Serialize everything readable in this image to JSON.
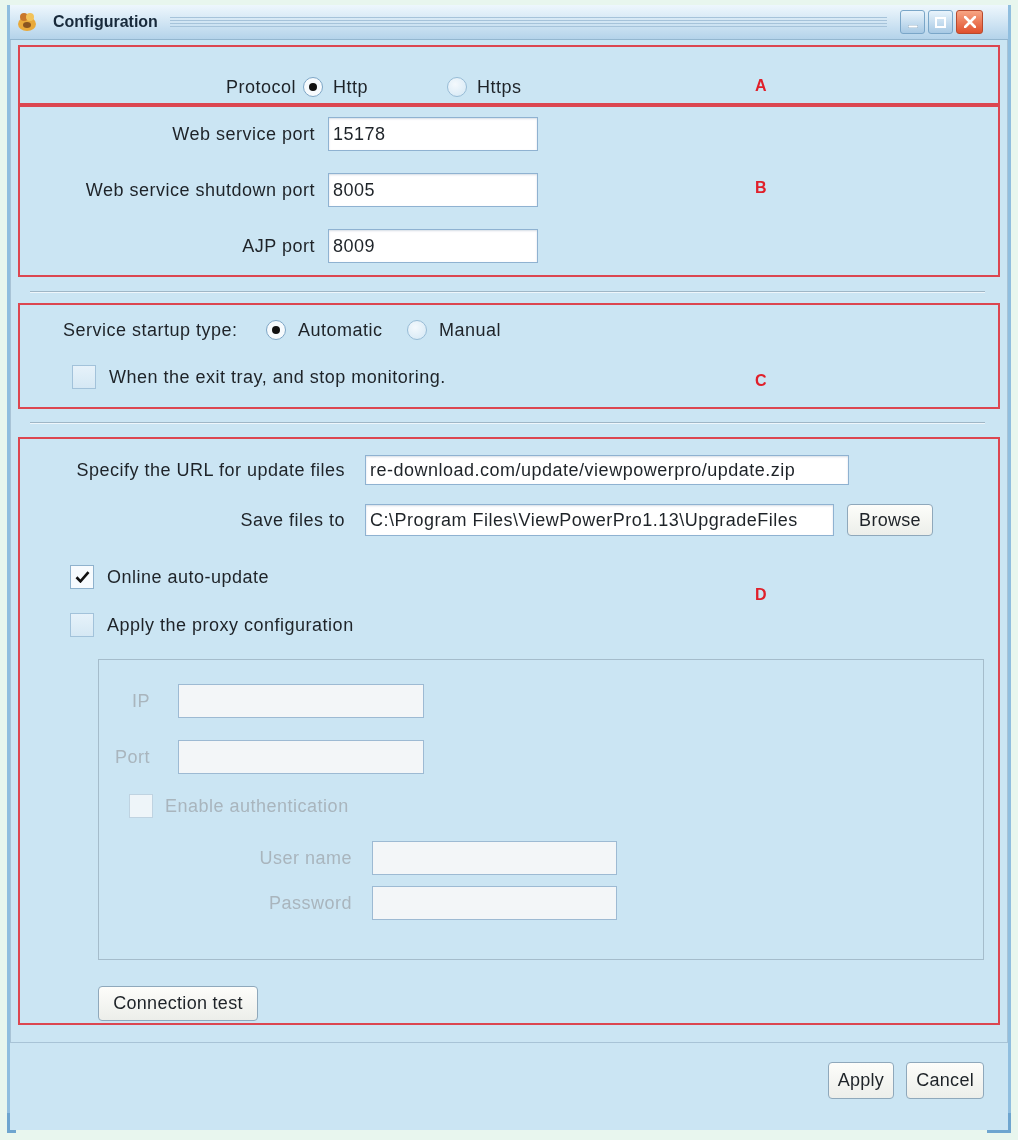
{
  "window": {
    "title": "Configuration"
  },
  "section_a": {
    "marker": "A",
    "label": "Protocol",
    "options": [
      {
        "label": "Http",
        "selected": true
      },
      {
        "label": "Https",
        "selected": false
      }
    ]
  },
  "section_b": {
    "marker": "B",
    "fields": [
      {
        "label": "Web service port",
        "value": "15178"
      },
      {
        "label": "Web service shutdown port",
        "value": "8005"
      },
      {
        "label": "AJP port",
        "value": "8009"
      }
    ]
  },
  "section_c": {
    "marker": "C",
    "label": "Service startup type:",
    "options": [
      {
        "label": "Automatic",
        "selected": true
      },
      {
        "label": "Manual",
        "selected": false
      }
    ],
    "checkbox": {
      "label": "When the exit tray, and stop monitoring.",
      "checked": false
    }
  },
  "section_d": {
    "marker": "D",
    "url": {
      "label": "Specify the URL for update files",
      "value": "re-download.com/update/viewpowerpro/update.zip"
    },
    "save_to": {
      "label": "Save files to",
      "value": "C:\\Program Files\\ViewPowerPro1.13\\UpgradeFiles",
      "button": "Browse"
    },
    "checkboxes": [
      {
        "label": "Online auto-update",
        "checked": true
      },
      {
        "label": "Apply the proxy configuration",
        "checked": false
      }
    ],
    "proxy": {
      "disabled": true,
      "fields": [
        {
          "label": "IP"
        },
        {
          "label": "Port"
        }
      ],
      "auth": {
        "label": "Enable authentication",
        "checked": false
      },
      "auth_fields": [
        {
          "label": "User name"
        },
        {
          "label": "Password"
        }
      ]
    },
    "test_button": "Connection test"
  },
  "buttons": [
    "Apply",
    "Cancel"
  ]
}
